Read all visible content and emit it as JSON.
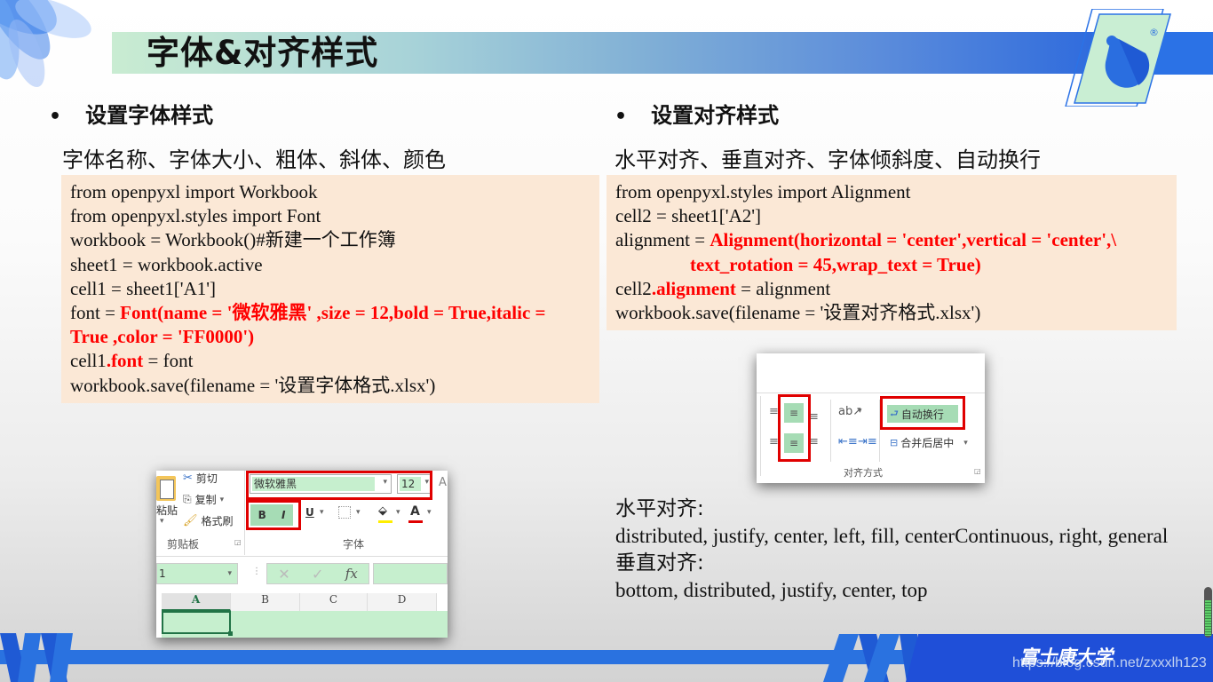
{
  "slide": {
    "title": "字体&对齐样式",
    "university": "富士康大学",
    "watermark": "https://blog.csdn.net/zxxxlh123",
    "logo_mark": "®",
    "progress_fraction": 0.7
  },
  "colors": {
    "code_bg": "#fbe8d6",
    "highlight_red": "#ff0000",
    "brand_blue": "#1f4fd8",
    "excel_green": "#c6efce"
  },
  "left_section": {
    "bullet": "•",
    "heading": "设置字体样式",
    "subheading": "字体名称、字体大小、粗体、斜体、颜色",
    "code_lines": [
      [
        {
          "t": "from openpyxl import Workbook",
          "red": false
        }
      ],
      [
        {
          "t": "from openpyxl.styles import Font",
          "red": false
        }
      ],
      [
        {
          "t": "workbook = Workbook()#新建一个工作簿",
          "red": false
        }
      ],
      [
        {
          "t": "sheet1 = workbook.active",
          "red": false
        }
      ],
      [
        {
          "t": "cell1 = sheet1['A1']",
          "red": false
        }
      ],
      [
        {
          "t": "font = ",
          "red": false
        },
        {
          "t": "Font(name = '微软雅黑' ,size = 12,bold = True,italic =",
          "red": true
        }
      ],
      [
        {
          "t": "True ,color = 'FF0000')",
          "red": true
        }
      ],
      [
        {
          "t": "cell1",
          "red": false
        },
        {
          "t": ".font",
          "red": true
        },
        {
          "t": " = font",
          "red": false
        }
      ],
      [
        {
          "t": "workbook.save(filename = '设置字体格式.xlsx')",
          "red": false
        }
      ]
    ],
    "excel": {
      "clipboard": {
        "paste_label": "粘贴",
        "cut_label": "剪切",
        "copy_label": "复制",
        "format_painter_label": "格式刷",
        "group_label": "剪贴板"
      },
      "font_group": {
        "font_name": "微软雅黑",
        "font_size": "12",
        "bold_label": "B",
        "italic_label": "I",
        "underline_label": "U",
        "font_color_label": "A",
        "group_label": "字体"
      },
      "formula_bar": {
        "name_box": "1",
        "cancel_symbol": "✕",
        "enter_symbol": "✓",
        "fx_label": "fx"
      },
      "columns": [
        "A",
        "B",
        "C",
        "D"
      ]
    }
  },
  "right_section": {
    "bullet": "•",
    "heading": "设置对齐样式",
    "subheading": "水平对齐、垂直对齐、字体倾斜度、自动换行",
    "code_lines": [
      [
        {
          "t": "from openpyxl.styles import Alignment",
          "red": false
        }
      ],
      [
        {
          "t": "cell2 = sheet1['A2']",
          "red": false
        }
      ],
      [
        {
          "t": "alignment = ",
          "red": false
        },
        {
          "t": "Alignment(horizontal = 'center',vertical = 'center',\\",
          "red": true
        }
      ],
      [
        {
          "t": "                text_rotation = 45,wrap_text = True)",
          "red": true
        }
      ],
      [
        {
          "t": "cell2",
          "red": false
        },
        {
          "t": ".alignment",
          "red": true
        },
        {
          "t": " = alignment",
          "red": false
        }
      ],
      [
        {
          "t": "workbook.save(filename = '设置对齐格式.xlsx')",
          "red": false
        }
      ]
    ],
    "excel": {
      "wrap_text_label": "自动换行",
      "merge_center_label": "合并后居中",
      "group_label": "对齐方式"
    },
    "horizontal_label": "水平对齐:",
    "horizontal_values": "distributed, justify, center, left, fill, centerContinuous, right, general",
    "vertical_label": "垂直对齐:",
    "vertical_values": "bottom, distributed, justify, center, top"
  }
}
